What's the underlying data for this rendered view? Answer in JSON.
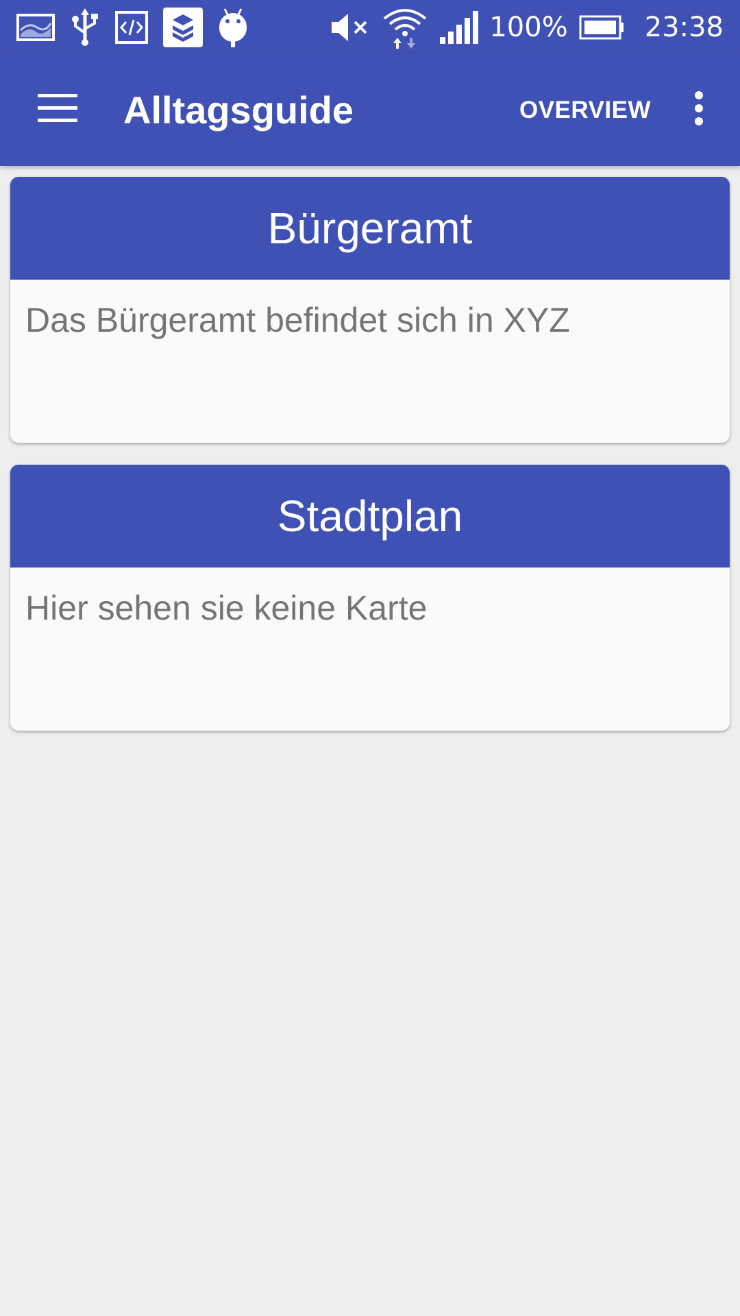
{
  "status_bar": {
    "left_icons": [
      "gallery-icon",
      "usb-icon",
      "code-icon",
      "app-badge-icon",
      "android-debug-icon"
    ],
    "right_icons": [
      "mute-icon",
      "wifi-icon",
      "signal-icon",
      "battery-icon"
    ],
    "battery_text": "100%",
    "time": "23:38"
  },
  "app_bar": {
    "title": "Alltagsguide",
    "menu_icon": "hamburger-menu-icon",
    "action_label": "OVERVIEW",
    "more_icon": "more-vert-icon"
  },
  "cards": [
    {
      "title": "Bürgeramt",
      "body": "Das Bürgeramt befindet sich in XYZ"
    },
    {
      "title": "Stadtplan",
      "body": "Hier sehen sie keine Karte"
    }
  ],
  "colors": {
    "primary": "#3f51b5",
    "background": "#eeeeee",
    "card_background": "#fafafa",
    "body_text": "#757575"
  }
}
